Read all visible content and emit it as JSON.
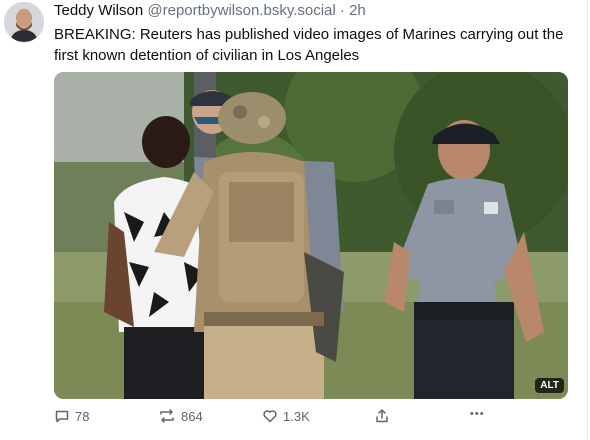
{
  "post": {
    "author_name": "Teddy Wilson",
    "handle": "@reportbywilson.bsky.social",
    "separator": "·",
    "time": "2h",
    "text": "BREAKING: Reuters has published video images of Marines carrying out the first known detention of civilian in Los Angeles",
    "image": {
      "alt_badge": "ALT"
    },
    "actions": {
      "reply_count": "78",
      "repost_count": "864",
      "like_count": "1.3K",
      "more_label": "•••"
    }
  },
  "colors": {
    "text": "#0b0f14",
    "muted": "#66717f",
    "icon": "#5a6572"
  },
  "icons": [
    "avatar",
    "reply-icon",
    "repost-icon",
    "like-icon",
    "share-icon",
    "more-icon"
  ]
}
